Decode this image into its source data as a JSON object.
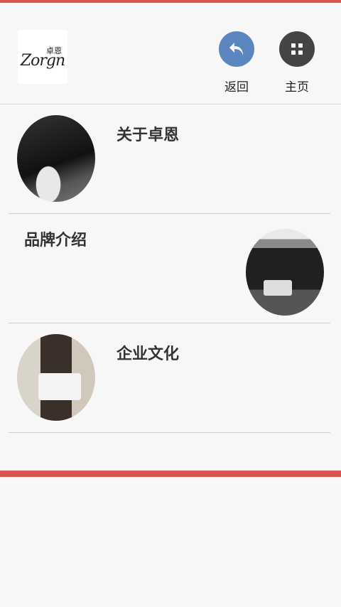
{
  "header": {
    "logo_cn": "卓恩",
    "logo_en": "Zorgn",
    "back_label": "返回",
    "home_label": "主页"
  },
  "items": [
    {
      "title": "关于卓恩"
    },
    {
      "title": "品牌介绍"
    },
    {
      "title": "企业文化"
    }
  ],
  "colors": {
    "accent": "#d9534f",
    "back_button": "#5b86c0",
    "home_button": "#444444"
  }
}
